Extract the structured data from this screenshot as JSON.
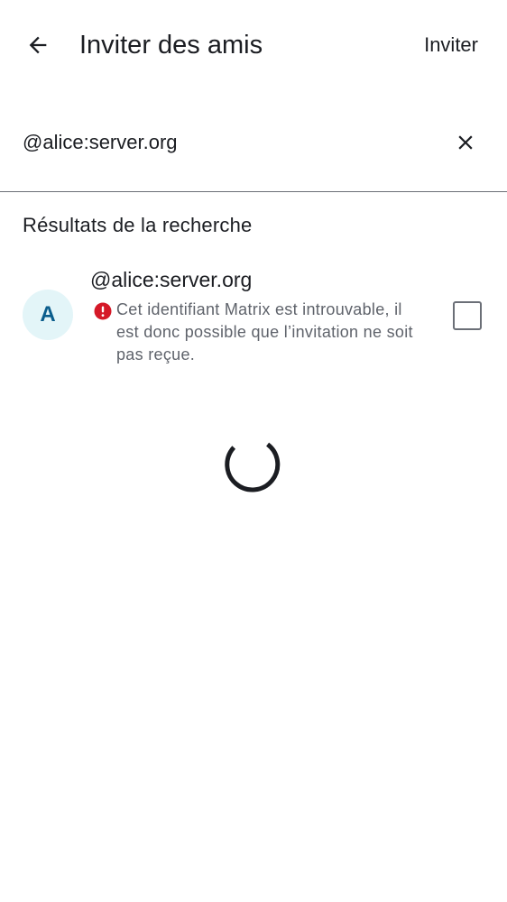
{
  "header": {
    "title": "Inviter des amis",
    "invite_label": "Inviter"
  },
  "search": {
    "value": "@alice:server.org"
  },
  "results": {
    "section_title": "Résultats de la recherche",
    "items": [
      {
        "avatar_initial": "A",
        "name": "@alice:server.org",
        "warning": "Cet identifiant Matrix est introuvable, il est donc possible que l’invitation ne soit pas reçue.",
        "checked": false
      }
    ]
  },
  "loading": true,
  "colors": {
    "text_primary": "#1b1d22",
    "text_secondary": "#5f636b",
    "avatar_bg": "#e3f5f8",
    "avatar_fg": "#0a5d8c",
    "error": "#d51928"
  },
  "icons": {
    "back": "arrow-left-icon",
    "clear": "close-icon",
    "warning": "error-icon",
    "spinner": "loading-spinner"
  }
}
